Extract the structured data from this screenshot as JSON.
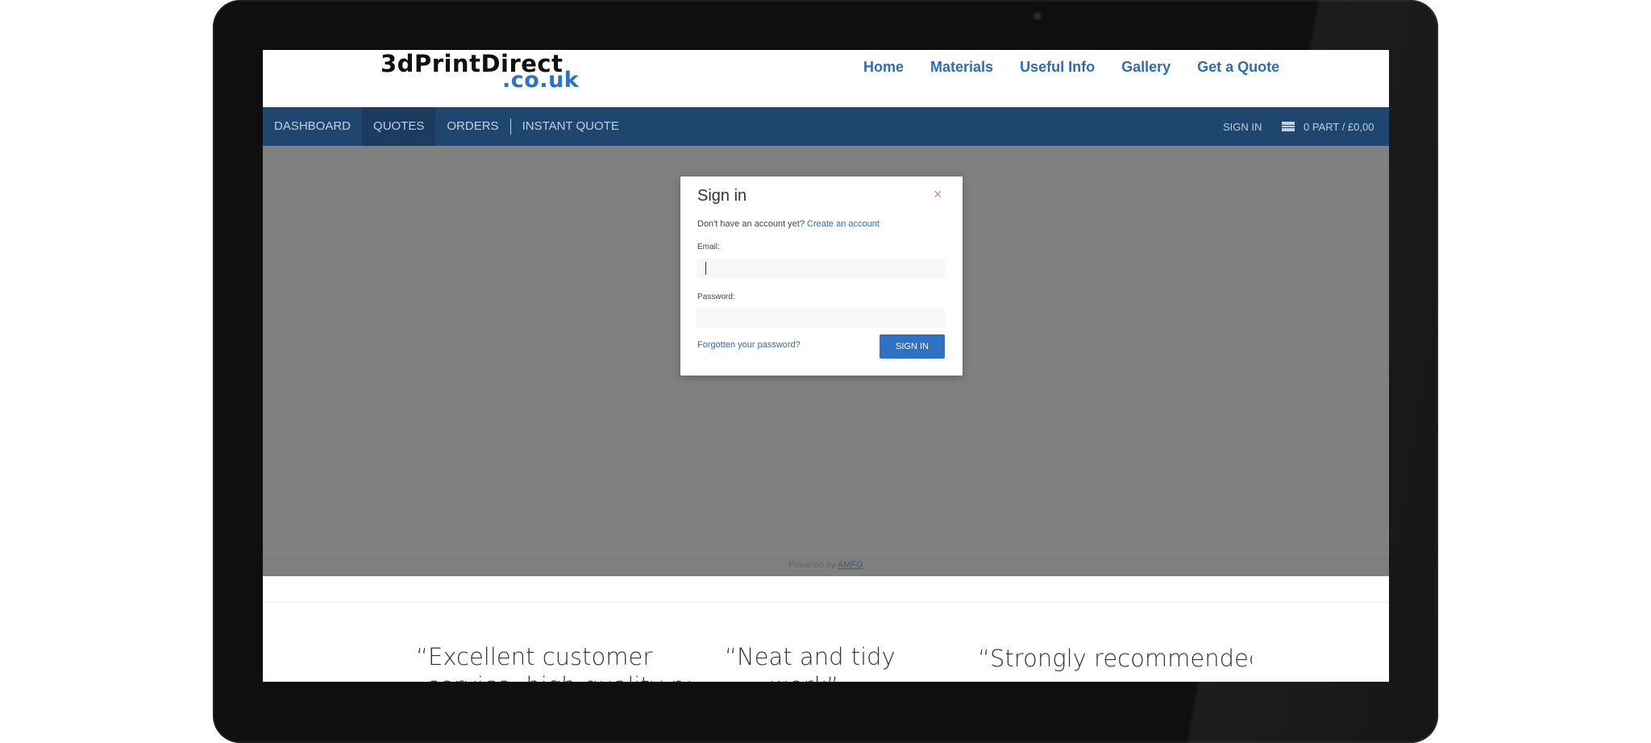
{
  "header": {
    "logo_top": "3dPrintDirect",
    "logo_bottom": ".co.uk",
    "nav": [
      "Home",
      "Materials",
      "Useful Info",
      "Gallery",
      "Get a Quote"
    ]
  },
  "app_nav": {
    "tabs": [
      "DASHBOARD",
      "QUOTES",
      "ORDERS",
      "INSTANT QUOTE"
    ],
    "active_tab": "QUOTES",
    "sign_in": "SIGN IN",
    "cart": "0 PART / £0,00"
  },
  "modal": {
    "title": "Sign in",
    "close_symbol": "×",
    "no_account_text": "Don't have an account yet?",
    "create_account_link": "Create an account",
    "email_label": "Email:",
    "email_value": "",
    "password_label": "Password:",
    "password_value": "",
    "forgot_link": "Forgotten your password?",
    "submit_label": "SIGN IN"
  },
  "footer": {
    "powered_by": "Powered by",
    "powered_by_link": "AMFG"
  },
  "testimonials": [
    {
      "line1": "“Excellent customer",
      "line2": "service, high quality parts"
    },
    {
      "line1": "“Neat and tidy",
      "line2": "work”"
    },
    {
      "line1": "“Strongly recommended”",
      "line2": ""
    }
  ],
  "colors": {
    "brand_blue": "#2e6db5",
    "nav_bar": "#1f466e",
    "overlay_grey": "#808080",
    "button_blue": "#2f72c5"
  }
}
